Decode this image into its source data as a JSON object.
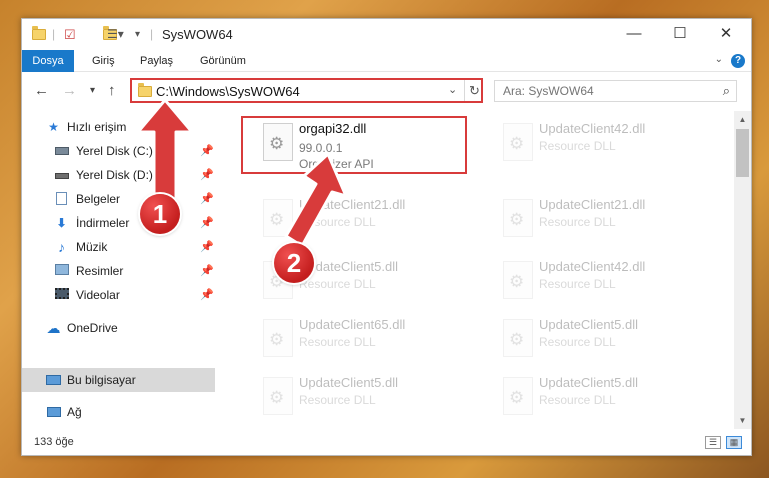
{
  "window": {
    "title": "SysWOW64",
    "controls": {
      "minimize": "—",
      "maximize": "☐",
      "close": "✕"
    }
  },
  "ribbon": {
    "tabs": [
      "Dosya",
      "Giriş",
      "Paylaş",
      "Görünüm"
    ],
    "help": "?"
  },
  "nav": {
    "path": "C:\\Windows\\SysWOW64",
    "search_placeholder": "Ara: SysWOW64"
  },
  "sidebar": {
    "items": [
      {
        "label": "Hızlı erişim",
        "icon": "star-icon"
      },
      {
        "label": "Yerel Disk (C:)",
        "icon": "drive-icon",
        "pinned": true
      },
      {
        "label": "Yerel Disk (D:)",
        "icon": "drive-icon",
        "pinned": true
      },
      {
        "label": "Belgeler",
        "icon": "documents-icon",
        "pinned": true
      },
      {
        "label": "İndirmeler",
        "icon": "download-icon",
        "pinned": true
      },
      {
        "label": "Müzik",
        "icon": "music-icon",
        "pinned": true
      },
      {
        "label": "Resimler",
        "icon": "pictures-icon",
        "pinned": true
      },
      {
        "label": "Videolar",
        "icon": "videos-icon",
        "pinned": true
      },
      {
        "label": "OneDrive",
        "icon": "cloud-icon"
      },
      {
        "label": "Bu bilgisayar",
        "icon": "computer-icon",
        "selected": true
      },
      {
        "label": "Ağ",
        "icon": "network-icon"
      }
    ]
  },
  "files": [
    {
      "name": "orgapi32.dll",
      "version": "99.0.0.1",
      "description": "Organizer API"
    },
    {
      "name": "UpdateClient42.dll",
      "version": "",
      "description": "Resource DLL"
    },
    {
      "name": "UpdateClient21.dll",
      "version": "",
      "description": "Resource DLL"
    },
    {
      "name": "UpdateClient21.dll",
      "version": "",
      "description": "Resource DLL"
    },
    {
      "name": "UpdateClient5.dll",
      "version": "",
      "description": "Resource DLL"
    },
    {
      "name": "UpdateClient42.dll",
      "version": "",
      "description": "Resource DLL"
    },
    {
      "name": "UpdateClient65.dll",
      "version": "",
      "description": "Resource DLL"
    },
    {
      "name": "UpdateClient5.dll",
      "version": "",
      "description": "Resource DLL"
    },
    {
      "name": "UpdateClient5.dll",
      "version": "",
      "description": "Resource DLL"
    },
    {
      "name": "UpdateClient5.dll",
      "version": "",
      "description": "Resource DLL"
    }
  ],
  "status": {
    "count": "133 öğe"
  },
  "annotations": {
    "badge1": "1",
    "badge2": "2",
    "color": "#d83b3b"
  }
}
